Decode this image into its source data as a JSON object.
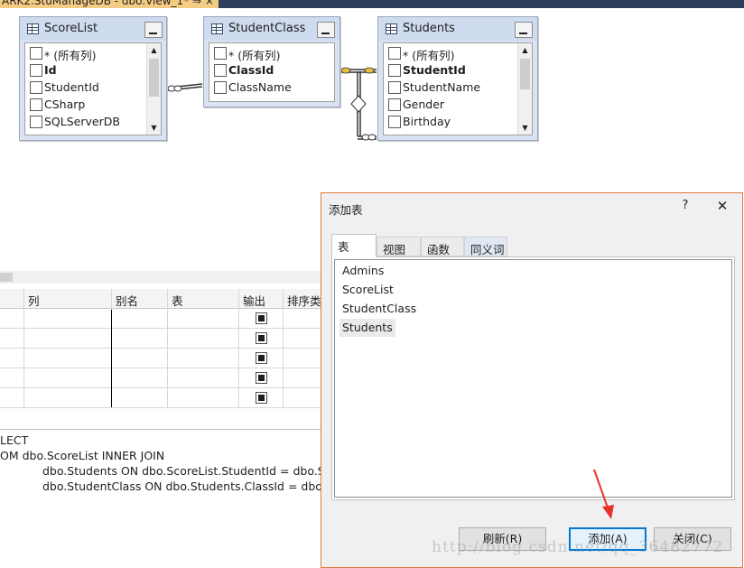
{
  "window": {
    "doc_tab_title": "ARK2.StuManageDB - dbo.View_1* ⇒ ×"
  },
  "diagram": {
    "tables": [
      {
        "name": "ScoreList",
        "rows": [
          {
            "label": "* (所有列)",
            "bold": false
          },
          {
            "label": "Id",
            "bold": true
          },
          {
            "label": "StudentId",
            "bold": false
          },
          {
            "label": "CSharp",
            "bold": false
          },
          {
            "label": "SQLServerDB",
            "bold": false
          }
        ]
      },
      {
        "name": "StudentClass",
        "rows": [
          {
            "label": "* (所有列)",
            "bold": false
          },
          {
            "label": "ClassId",
            "bold": true
          },
          {
            "label": "ClassName",
            "bold": false
          }
        ]
      },
      {
        "name": "Students",
        "rows": [
          {
            "label": "* (所有列)",
            "bold": false
          },
          {
            "label": "StudentId",
            "bold": true
          },
          {
            "label": "StudentName",
            "bold": false
          },
          {
            "label": "Gender",
            "bold": false
          },
          {
            "label": "Birthday",
            "bold": false
          }
        ]
      }
    ]
  },
  "grid": {
    "headers": [
      "列",
      "别名",
      "表",
      "输出",
      "排序类"
    ],
    "output_checked": [
      true,
      true,
      true,
      true,
      true
    ]
  },
  "sql": {
    "lines": [
      "LECT",
      "OM      dbo.ScoreList INNER JOIN",
      "dbo.Students ON dbo.ScoreList.StudentId = dbo.Stud",
      "dbo.StudentClass ON dbo.Students.ClassId = dbo.Stu"
    ]
  },
  "dialog": {
    "title": "添加表",
    "help": "?",
    "close": "✕",
    "tabs": [
      "表",
      "视图",
      "函数",
      "同义词"
    ],
    "active_tab": "表",
    "items": [
      "Admins",
      "ScoreList",
      "StudentClass",
      "Students"
    ],
    "selected_item": "Students",
    "buttons": {
      "refresh": "刷新(R)",
      "add": "添加(A)",
      "close": "关闭(C)"
    }
  },
  "watermark": "http://blog.csdn.net/qq_36482772",
  "colors": {
    "dialog_border": "#e07a3a",
    "add_button_border": "#0078d7",
    "arrow": "#e8322c",
    "title_bar": "#2d3f5c",
    "doc_tab": "#f5cc84"
  }
}
